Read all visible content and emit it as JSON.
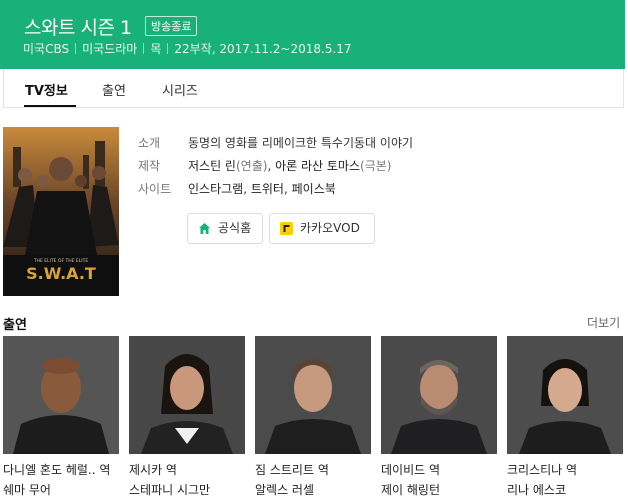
{
  "header": {
    "title": "스와트 시즌 1",
    "status_badge": "방송종료",
    "meta": [
      "미국CBS",
      "미국드라마",
      "목",
      "22부작, 2017.11.2~2018.5.17"
    ],
    "bg_color": "#19b17a"
  },
  "tabs": [
    {
      "label": "TV정보",
      "active": true
    },
    {
      "label": "출연",
      "active": false
    },
    {
      "label": "시리즈",
      "active": false
    }
  ],
  "poster": {
    "subtitle": "THE ELITE OF THE ELITE",
    "logo_text": "S.W.A.T"
  },
  "info": {
    "summary_label": "소개",
    "summary_value": "동명의 영화를 리메이크한 특수기동대 이야기",
    "crew_label": "제작",
    "crew_director": "저스틴 린",
    "crew_director_role": "(연출)",
    "crew_separator": ", ",
    "crew_writer": "아론 라산 토마스",
    "crew_writer_role": "(극본)",
    "sites_label": "사이트",
    "site_links": [
      "인스타그램",
      "트위터",
      "페이스북"
    ]
  },
  "buttons": {
    "official_home": "공식홈",
    "kakao_vod": "카카오VOD"
  },
  "cast_section": {
    "title": "출연",
    "more_label": "더보기",
    "members": [
      {
        "role": "다니엘 혼도 헤럴.. 역",
        "name": "쉐마 무어"
      },
      {
        "role": "제시카 역",
        "name": "스테파니 시그만"
      },
      {
        "role": "짐 스트리트 역",
        "name": "알렉스 러셀"
      },
      {
        "role": "데이비드 역",
        "name": "제이 해링턴"
      },
      {
        "role": "크리스티나 역",
        "name": "리나 에스코"
      }
    ]
  }
}
